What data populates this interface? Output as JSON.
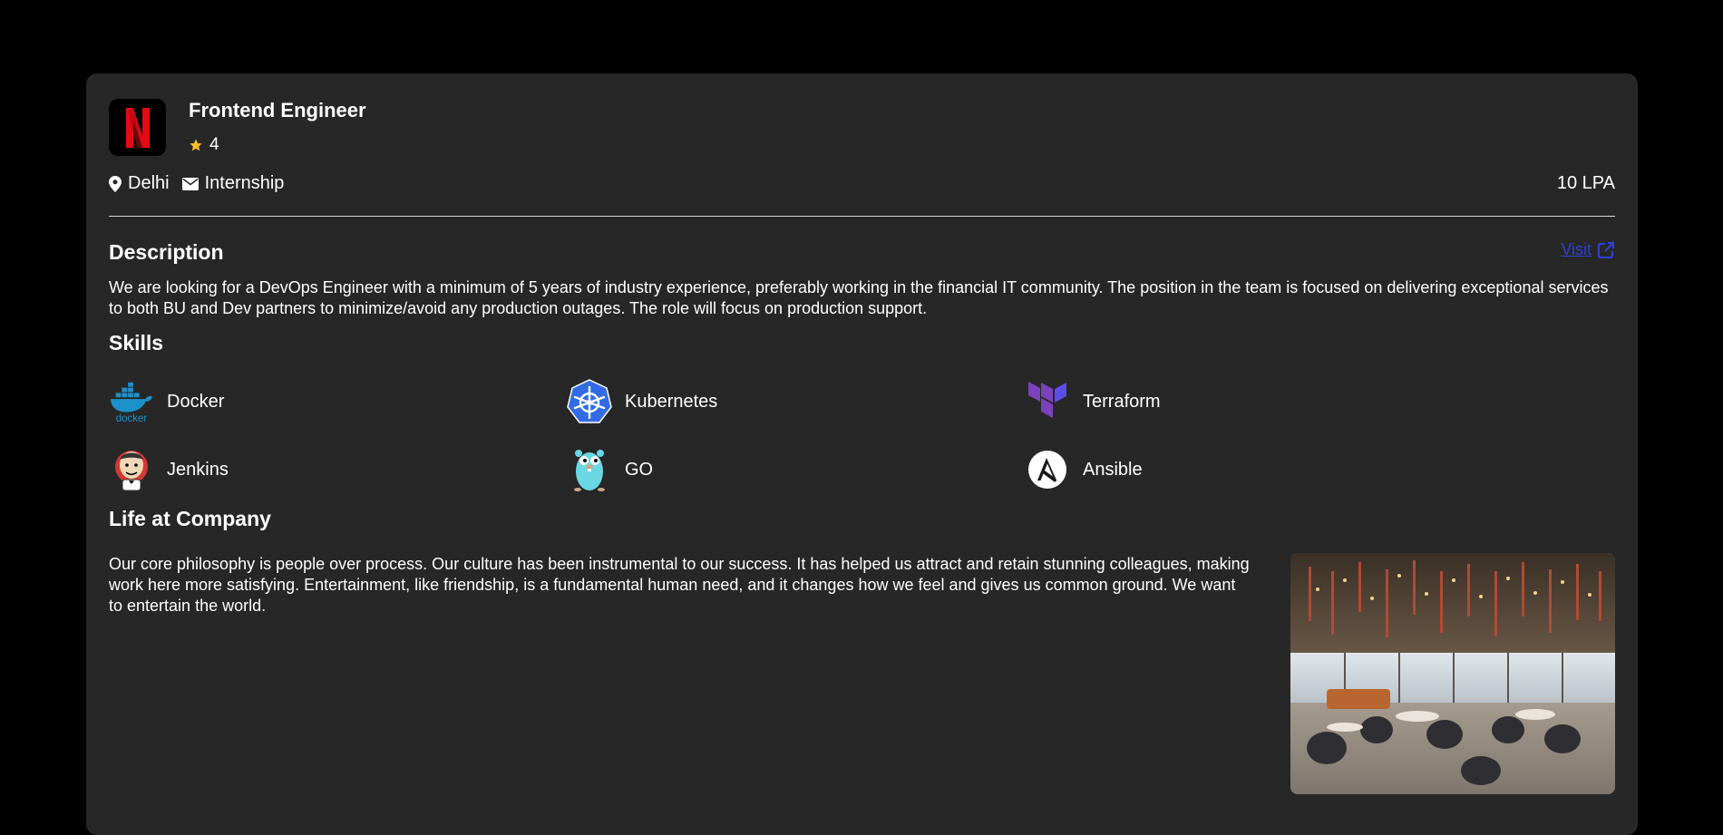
{
  "job": {
    "title": "Frontend Engineer",
    "rating": "4",
    "location": "Delhi",
    "employment_type": "Internship",
    "salary": "10 LPA",
    "company_logo_icon": "netflix-logo",
    "accent": "#e50914"
  },
  "description": {
    "heading": "Description",
    "visit_label": "Visit",
    "text": "We are looking for a DevOps Engineer with a minimum of 5 years of industry experience, preferably working in the financial IT community. The position in the team is focused on delivering exceptional services to both BU and Dev partners to minimize/avoid any production outages. The role will focus on production support."
  },
  "skills": {
    "heading": "Skills",
    "items": [
      {
        "name": "Docker",
        "icon": "docker-icon"
      },
      {
        "name": "Kubernetes",
        "icon": "kubernetes-icon"
      },
      {
        "name": "Terraform",
        "icon": "terraform-icon"
      },
      {
        "name": "Jenkins",
        "icon": "jenkins-icon"
      },
      {
        "name": "GO",
        "icon": "go-gopher-icon"
      },
      {
        "name": "Ansible",
        "icon": "ansible-icon"
      }
    ]
  },
  "life": {
    "heading": "Life at Company",
    "text": "Our core philosophy is people over process. Our culture has been instrumental to our success. It has helped us attract and retain stunning colleagues, making work here more satisfying. Entertainment, like friendship, is a fundamental human need, and it changes how we feel and gives us common ground. We want to entertain the world."
  },
  "colors": {
    "page_bg": "#000000",
    "card_bg": "#272727",
    "star": "#fbbf24",
    "link": "#2f3fd9"
  }
}
